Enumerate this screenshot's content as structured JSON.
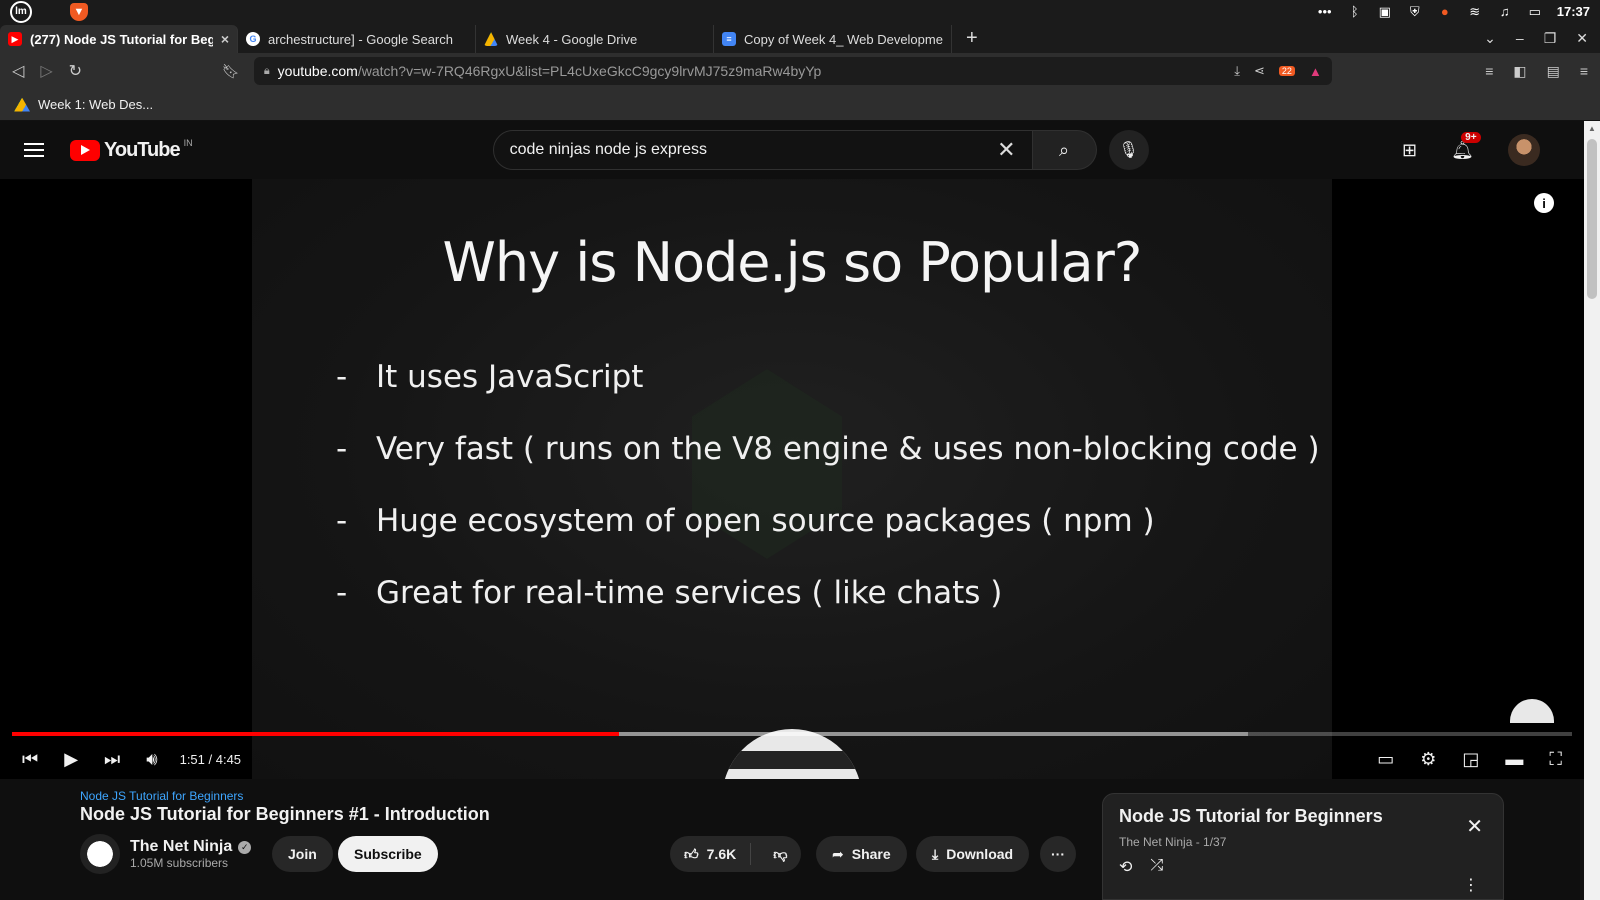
{
  "os": {
    "clock": "17:37"
  },
  "tabs": [
    {
      "title": "(277) Node JS Tutorial for Beg",
      "close": "×"
    },
    {
      "title": "archestructure] - Google Search"
    },
    {
      "title": "Week 4 - Google Drive"
    },
    {
      "title": "Copy of Week 4_ Web Developmer"
    }
  ],
  "newtab": "+",
  "address": {
    "host": "youtube.com",
    "path": "/watch?v=w-7RQ46RgxU&list=PL4cUxeGkcC9gcy9lrvMJ75z9maRw4byYp",
    "shield_count": "22"
  },
  "bookmarks": [
    {
      "label": "Week 1: Web Des..."
    }
  ],
  "youtube": {
    "logo": "YouTube",
    "region": "IN",
    "search_value": "code ninjas node js express",
    "notif_badge": "9+"
  },
  "slide": {
    "title": "Why is Node.js so Popular?",
    "bullets": [
      "It uses JavaScript",
      "Very fast ( runs on the V8 engine & uses non-blocking code )",
      "Huge ecosystem of open source packages ( npm )",
      "Great for real-time services ( like chats )"
    ],
    "dash": "-"
  },
  "player": {
    "time": "1:51 / 4:45",
    "played_fraction": 0.389,
    "buffered_fraction": 0.792
  },
  "video": {
    "playlist_link": "Node JS Tutorial for Beginners",
    "title": "Node JS Tutorial for Beginners #1 - Introduction",
    "channel": "The Net Ninja",
    "subscribers": "1.05M subscribers",
    "join": "Join",
    "subscribe": "Subscribe",
    "likes": "7.6K",
    "share": "Share",
    "download": "Download",
    "more": "···"
  },
  "playlist": {
    "title": "Node JS Tutorial for Beginners",
    "meta": "The Net Ninja - 1/37"
  },
  "colors": {
    "accent": "#ff0000",
    "link": "#3ea6ff"
  }
}
